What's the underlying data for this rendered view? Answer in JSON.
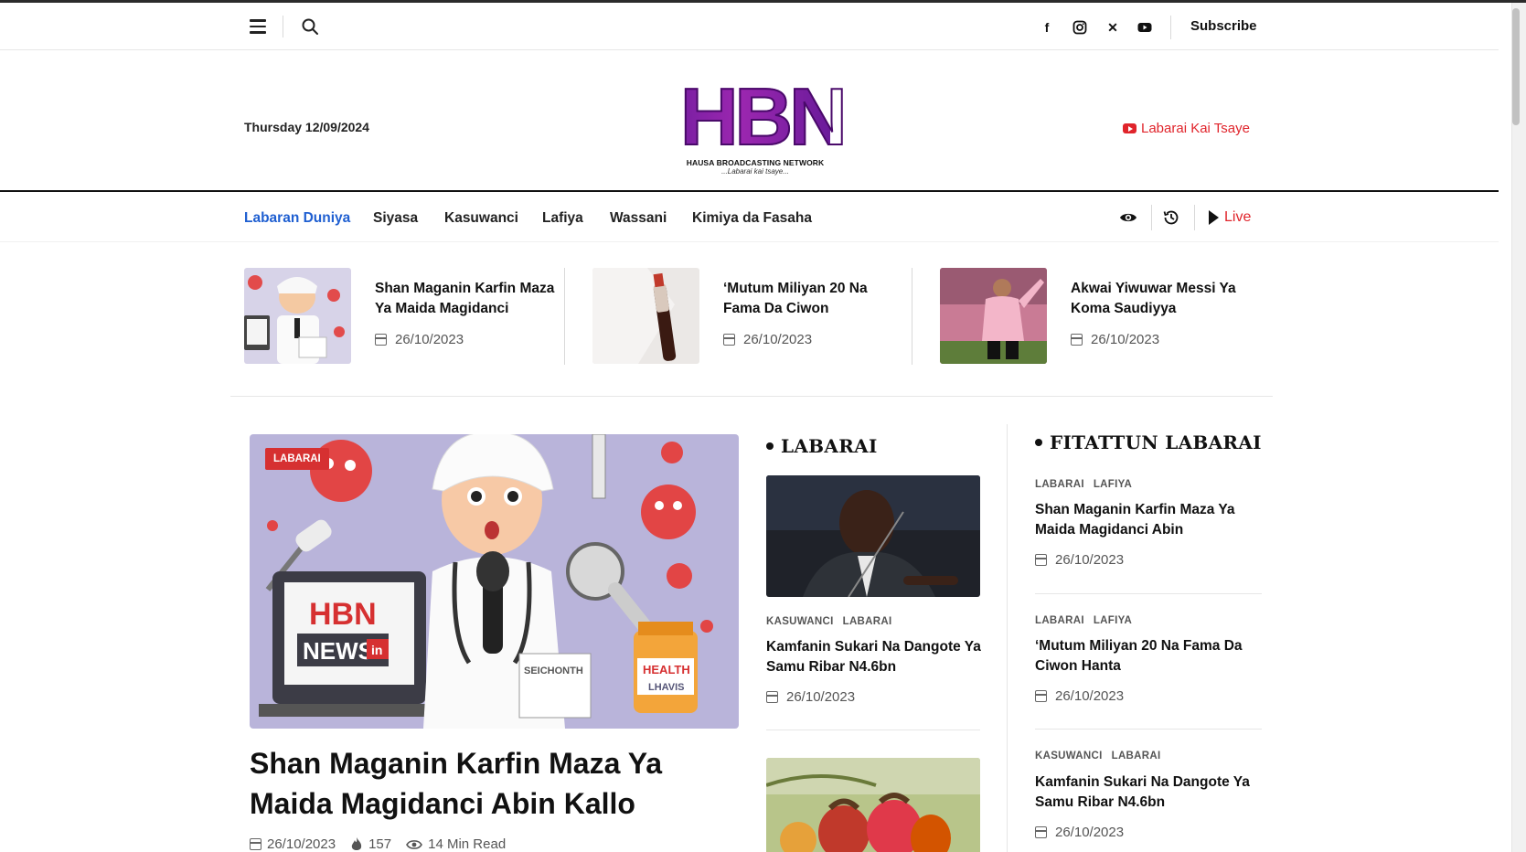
{
  "topbar": {
    "subscribe_label": "Subscribe",
    "social_icons": [
      "facebook-icon",
      "instagram-icon",
      "x-icon",
      "youtube-icon"
    ]
  },
  "header": {
    "date": "Thursday 12/09/2024",
    "logo_letters": "HBN",
    "logo_subtitle": "HAUSA BROADCASTING NETWORK",
    "logo_tagline": "...Labarai kai tsaye...",
    "youtube_link": "Labarai Kai Tsaye",
    "accent_color": "#e0242b",
    "brand_color": "#8e24aa"
  },
  "nav": {
    "items": [
      "Labaran Duniya",
      "Siyasa",
      "Kasuwanci",
      "Lafiya",
      "Wassani",
      "Kimiya da Fasaha"
    ],
    "active_index": 0,
    "live_label": "Live"
  },
  "ticker": [
    {
      "title": "Shan Maganin Karfin Maza Ya Maida Magidanci",
      "date": "26/10/2023"
    },
    {
      "title": "‘Mutum Miliyan 20 Na Fama Da Ciwon",
      "date": "26/10/2023"
    },
    {
      "title": "Akwai Yiwuwar Messi Ya Koma Saudiyya",
      "date": "26/10/2023"
    }
  ],
  "featured": {
    "category": "LABARAI",
    "title": "Shan Maganin Karfin Maza Ya Maida Magidanci Abin Kallo",
    "date": "26/10/2023",
    "views": "157",
    "read_time": "14 Min Read",
    "image_text": {
      "hbn": "HBN",
      "news": "NEWS",
      "in": "in",
      "sign": "SEICHONTH",
      "jar_top": "HEALTH",
      "jar_bottom": "LHAVIS"
    }
  },
  "labarai": {
    "heading": "LABARAI",
    "cards": [
      {
        "cats": [
          "KASUWANCI",
          "LABARAI"
        ],
        "title": "Kamfanin Sukari Na Dangote Ya Samu Ribar N4.6bn",
        "date": "26/10/2023"
      }
    ]
  },
  "fitattun": {
    "heading": "FITATTUN LABARAI",
    "items": [
      {
        "cats": [
          "LABARAI",
          "LAFIYA"
        ],
        "title": "Shan Maganin Karfin Maza Ya Maida Magidanci Abin",
        "date": "26/10/2023"
      },
      {
        "cats": [
          "LABARAI",
          "LAFIYA"
        ],
        "title": "‘Mutum Miliyan 20 Na Fama Da Ciwon Hanta",
        "date": "26/10/2023"
      },
      {
        "cats": [
          "KASUWANCI",
          "LABARAI"
        ],
        "title": "Kamfanin Sukari Na Dangote Ya Samu Ribar N4.6bn",
        "date": "26/10/2023"
      }
    ]
  }
}
